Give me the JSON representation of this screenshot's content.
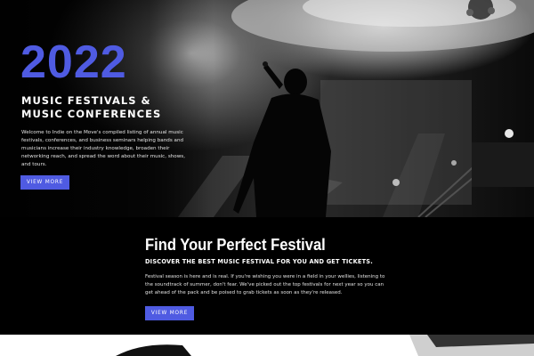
{
  "hero": {
    "year": "2022",
    "headline_line1": "MUSIC FESTIVALS &",
    "headline_line2": "MUSIC CONFERENCES",
    "intro": "Welcome to Indie on the Move's compiled listing of annual music festivals, conferences, and business seminars helping bands and musicians increase their industry knowledge, broaden their networking reach, and spread the word about their music, shows, and tours.",
    "button_label": "VIEW MORE",
    "image": "performer-on-stage-photo"
  },
  "festival": {
    "title": "Find Your Perfect Festival",
    "subtitle": "DISCOVER THE BEST MUSIC FESTIVAL FOR YOU AND GET TICKETS.",
    "body": "Festival season is here and is real. If you're wishing you were in a field in your wellies, listening to the soundtrack of summer, don't fear. We've picked out the top festivals for next year so you can get ahead of the pack and be poised to grab tickets as soon as they're released.",
    "button_label": "VIEW MORE"
  },
  "colors": {
    "accent": "#4f5be2",
    "background": "#000000",
    "text": "#ffffff"
  }
}
